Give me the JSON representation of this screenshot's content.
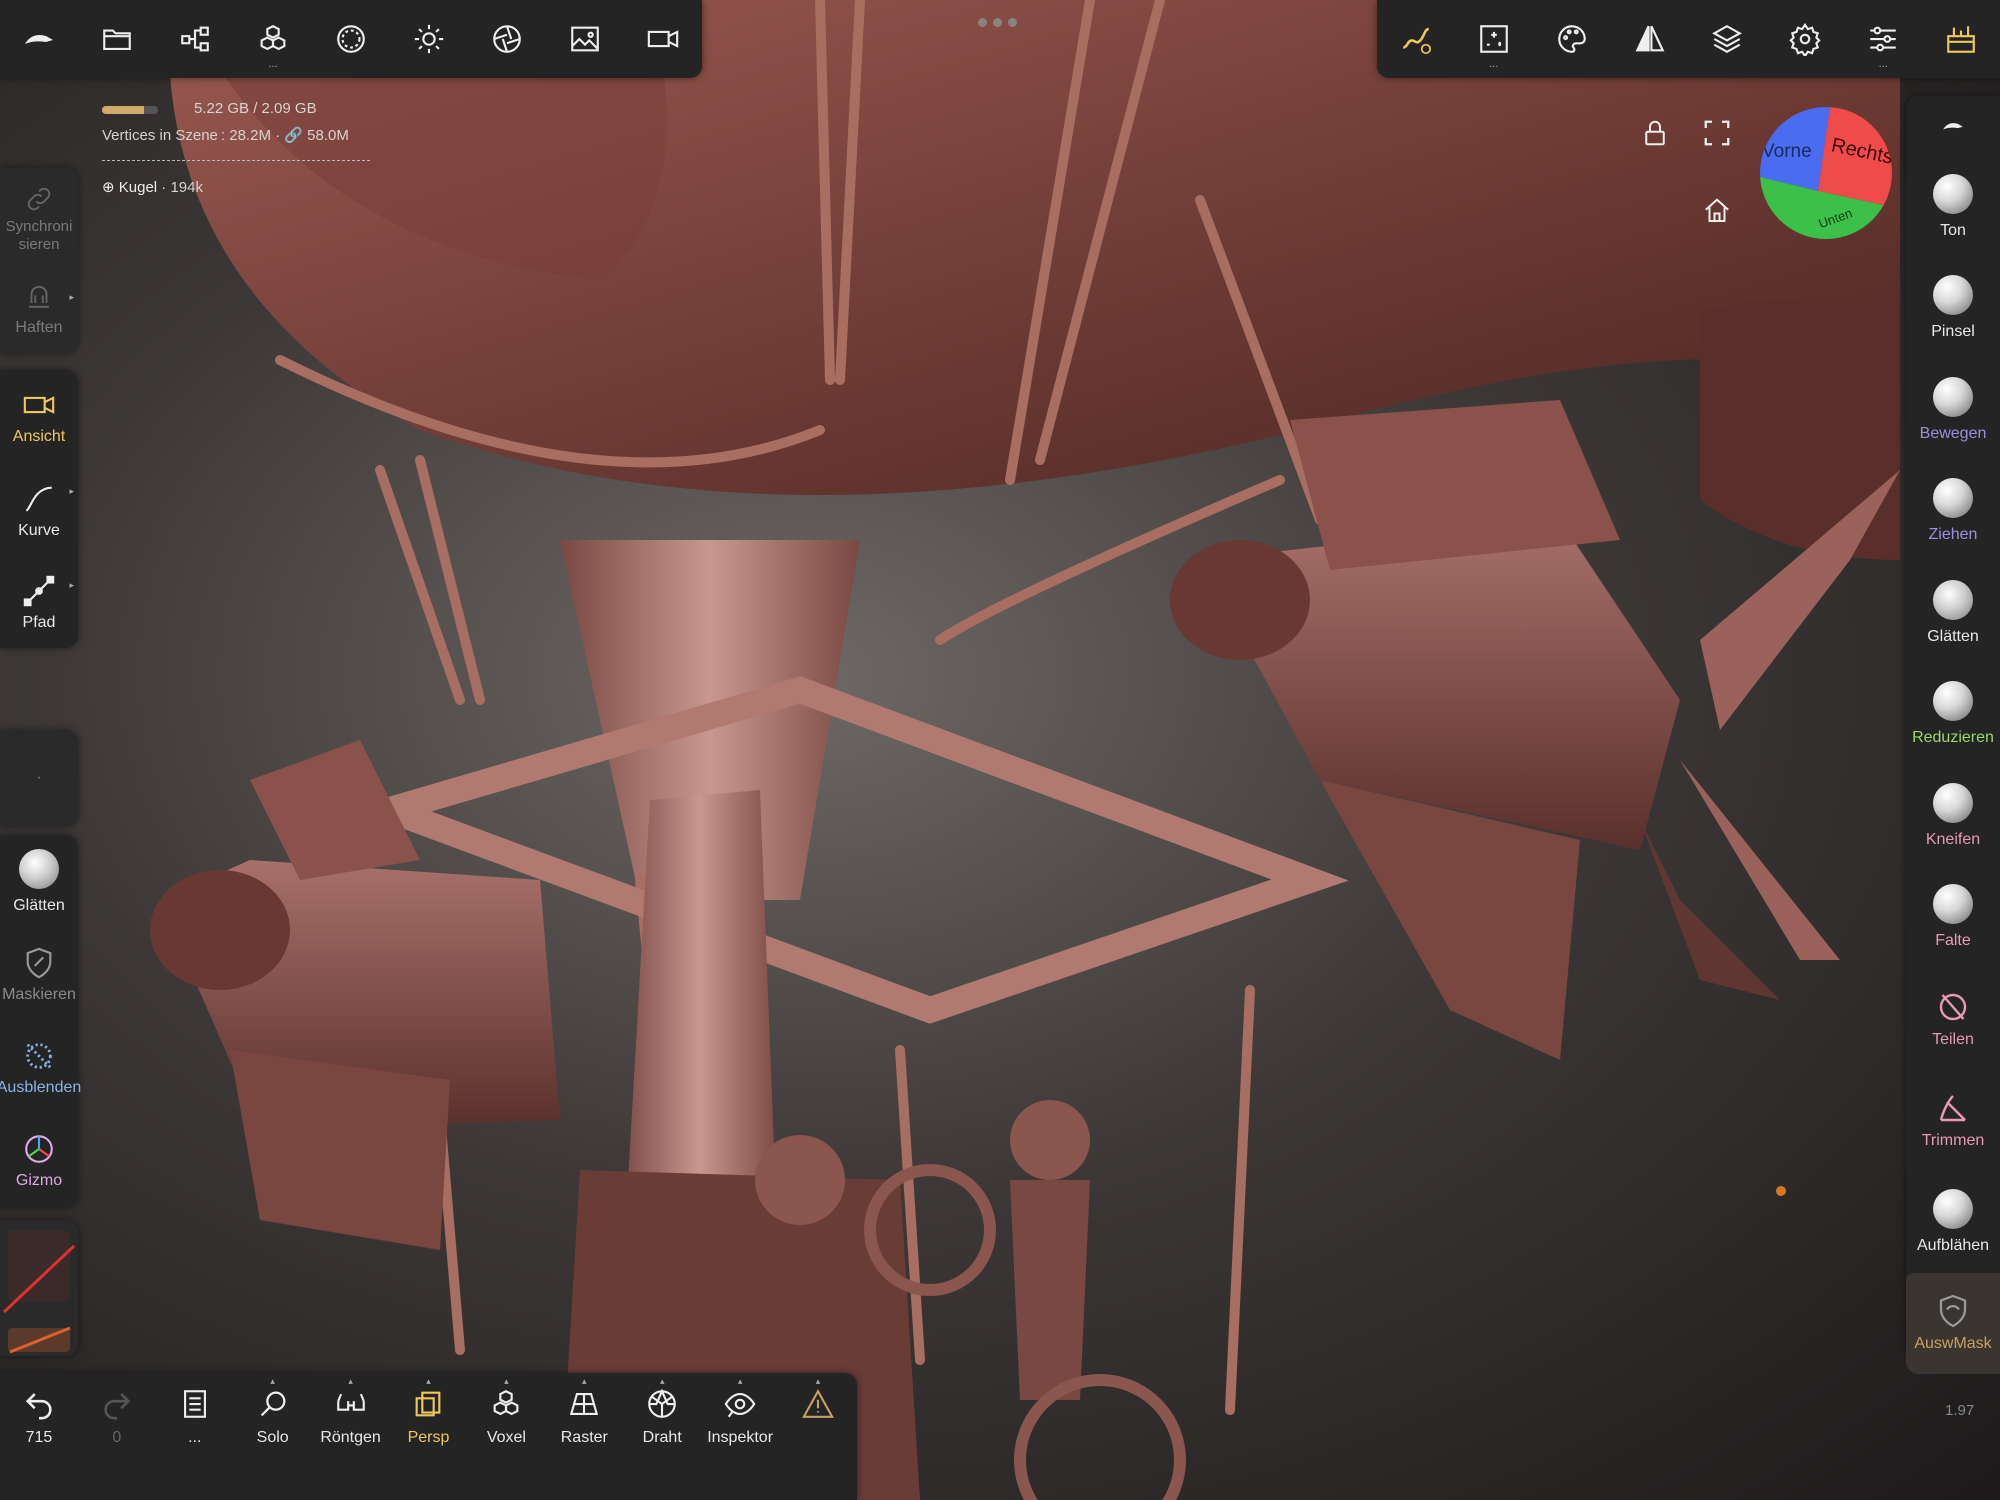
{
  "top_left_toolbar": [
    {
      "name": "logo-icon"
    },
    {
      "name": "folder-icon"
    },
    {
      "name": "scene-tree-icon"
    },
    {
      "name": "primitives-icon",
      "dots": "..."
    },
    {
      "name": "material-icon"
    },
    {
      "name": "light-icon"
    },
    {
      "name": "post-process-icon"
    },
    {
      "name": "background-image-icon"
    },
    {
      "name": "camera-icon"
    }
  ],
  "top_right_toolbar": [
    {
      "name": "stroke-icon"
    },
    {
      "name": "painting-icon",
      "dots": "..."
    },
    {
      "name": "palette-icon"
    },
    {
      "name": "symmetry-icon"
    },
    {
      "name": "layers-icon"
    },
    {
      "name": "settings-icon"
    },
    {
      "name": "sliders-icon",
      "dots": "..."
    },
    {
      "name": "interface-icon"
    }
  ],
  "info": {
    "memory": "5.22 GB / 2.09 GB",
    "memory_fraction": 0.75,
    "vertices_label": "Vertices in Szene :",
    "vertices": "28.2M",
    "vertices_linked": "58.0M",
    "object_name": "Kugel",
    "object_tris": "194k"
  },
  "left_panel_top": [
    {
      "label": "Synchroni sieren",
      "icon": "link-icon",
      "muted": true
    },
    {
      "label": "Haften",
      "icon": "stick-icon",
      "muted": true
    }
  ],
  "left_panel_tools": [
    {
      "label": "Ansicht",
      "icon": "view-camera-icon",
      "color": "#f0c85a"
    },
    {
      "label": "Kurve",
      "icon": "curve-icon",
      "color": "#e8e8e8"
    },
    {
      "label": "Pfad",
      "icon": "path-icon",
      "color": "#e8e8e8"
    }
  ],
  "left_panel_bottom": [
    {
      "label": "Glätten",
      "icon": "smooth-sphere-icon",
      "color": "#e8e8e8"
    },
    {
      "label": "Maskieren",
      "icon": "mask-icon",
      "color": "#8a8a8a"
    },
    {
      "label": "Ausblenden",
      "icon": "hide-icon",
      "color": "#8ab4e8"
    },
    {
      "label": "Gizmo",
      "icon": "gizmo-icon",
      "color": "#e0a8e8"
    }
  ],
  "right_brushes": [
    {
      "label": "",
      "icon": "brush-logo-icon",
      "color": "#e8e8e8"
    },
    {
      "label": "Ton",
      "color": "#e8e8e8"
    },
    {
      "label": "Pinsel",
      "color": "#e8e8e8"
    },
    {
      "label": "Bewegen",
      "color": "#9a90e0"
    },
    {
      "label": "Ziehen",
      "color": "#9a90e0"
    },
    {
      "label": "Glätten",
      "color": "#e8e8e8"
    },
    {
      "label": "Reduzieren",
      "color": "#9ad86a"
    },
    {
      "label": "Kneifen",
      "color": "#e89ab0"
    },
    {
      "label": "Falte",
      "color": "#e89ab0"
    },
    {
      "label": "Teilen",
      "icon": "split-icon",
      "color": "#e89ab0"
    },
    {
      "label": "Trimmen",
      "icon": "trim-icon",
      "color": "#e89ab0"
    },
    {
      "label": "Aufblähen",
      "color": "#e8e8e8"
    },
    {
      "label": "AuswMask",
      "icon": "select-mask-icon",
      "color": "#c8a060"
    }
  ],
  "bottom_bar": [
    {
      "label": "715",
      "icon": "undo-icon",
      "color": "#e8e8e8"
    },
    {
      "label": "0",
      "icon": "redo-icon",
      "color": "#666"
    },
    {
      "label": "...",
      "icon": "notes-icon",
      "color": "#e8e8e8"
    },
    {
      "label": "Solo",
      "icon": "search-icon",
      "color": "#e8e8e8",
      "caret": true
    },
    {
      "label": "Röntgen",
      "icon": "xray-glasses-icon",
      "color": "#e8e8e8",
      "caret": true
    },
    {
      "label": "Persp",
      "icon": "perspective-icon",
      "color": "#f0c85a",
      "caret": true
    },
    {
      "label": "Voxel",
      "icon": "voxel-icon",
      "color": "#e8e8e8",
      "caret": true
    },
    {
      "label": "Raster",
      "icon": "grid-icon",
      "color": "#e8e8e8",
      "caret": true
    },
    {
      "label": "Draht",
      "icon": "wireframe-icon",
      "color": "#e8e8e8",
      "caret": true
    },
    {
      "label": "Inspektor",
      "icon": "inspector-eye-icon",
      "color": "#e8e8e8",
      "caret": true
    },
    {
      "label": "",
      "icon": "warning-icon",
      "color": "#c8a060",
      "caret": true
    }
  ],
  "cube": {
    "front": "Vorne",
    "right": "Rechts",
    "bottom": "Unten"
  },
  "version": "1.97"
}
